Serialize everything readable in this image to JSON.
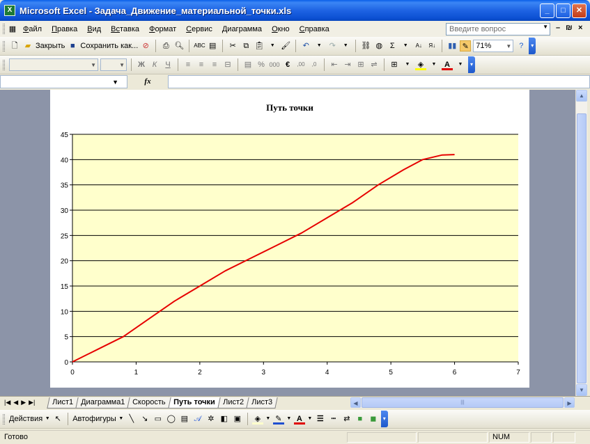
{
  "window": {
    "app_icon": "X",
    "title": "Microsoft Excel - Задача_Движение_материальной_точки.xls"
  },
  "menu": {
    "items": [
      {
        "ul": "Ф",
        "rest": "айл"
      },
      {
        "ul": "П",
        "rest": "равка"
      },
      {
        "ul": "В",
        "rest": "ид"
      },
      {
        "ul": "Вс",
        "rest": "тавка"
      },
      {
        "ul": "Ф",
        "rest": "ормат"
      },
      {
        "ul": "С",
        "rest": "ервис"
      },
      {
        "ul": "Д",
        "rest": "иаграмма"
      },
      {
        "ul": "О",
        "rest": "кно"
      },
      {
        "ul": "С",
        "rest": "правка"
      }
    ],
    "help_placeholder": "Введите вопрос",
    "doc_minimize": "–",
    "doc_restore": "₪",
    "doc_close": "×"
  },
  "standard_toolbar": {
    "close_label": "Закрыть",
    "save_as_label": "Сохранить как...",
    "zoom": "71%"
  },
  "format_toolbar": {
    "bold": "Ж",
    "italic": "К",
    "underline": "Ч",
    "percent": "%",
    "thousands": "000",
    "euro": "€",
    "font_color_letter": "A"
  },
  "formula_bar": {
    "fx": "fx"
  },
  "sheet_tabs": {
    "tabs": [
      "Лист1",
      "Диаграмма1",
      "Скорость",
      "Путь точки",
      "Лист2",
      "Лист3"
    ],
    "active": "Путь точки"
  },
  "drawing_toolbar": {
    "actions": "Действия",
    "autoshapes": "Автофигуры"
  },
  "status": {
    "ready": "Готово",
    "num": "NUM"
  },
  "colors": {
    "plot_bg": "#ffffcc",
    "line": "#e60000",
    "titlebar": "#1e63e3"
  },
  "chart_data": {
    "type": "line",
    "title": "Путь точки",
    "xlim": [
      0,
      7
    ],
    "ylim": [
      0,
      45
    ],
    "x_ticks": [
      0,
      1,
      2,
      3,
      4,
      5,
      6,
      7
    ],
    "y_ticks": [
      0,
      5,
      10,
      15,
      20,
      25,
      30,
      35,
      40,
      45
    ],
    "grid": "horizontal",
    "legend": "none",
    "series": [
      {
        "color": "#e60000",
        "x": [
          0,
          0.4,
          0.8,
          1.2,
          1.6,
          2.0,
          2.4,
          2.8,
          3.2,
          3.6,
          4.0,
          4.4,
          4.8,
          5.2,
          5.5,
          5.8,
          6.0
        ],
        "y": [
          0,
          2.5,
          5.0,
          8.5,
          12.0,
          15.0,
          18.0,
          20.5,
          23.0,
          25.5,
          28.5,
          31.5,
          35.0,
          38.0,
          40.0,
          40.9,
          41.0
        ]
      }
    ]
  }
}
